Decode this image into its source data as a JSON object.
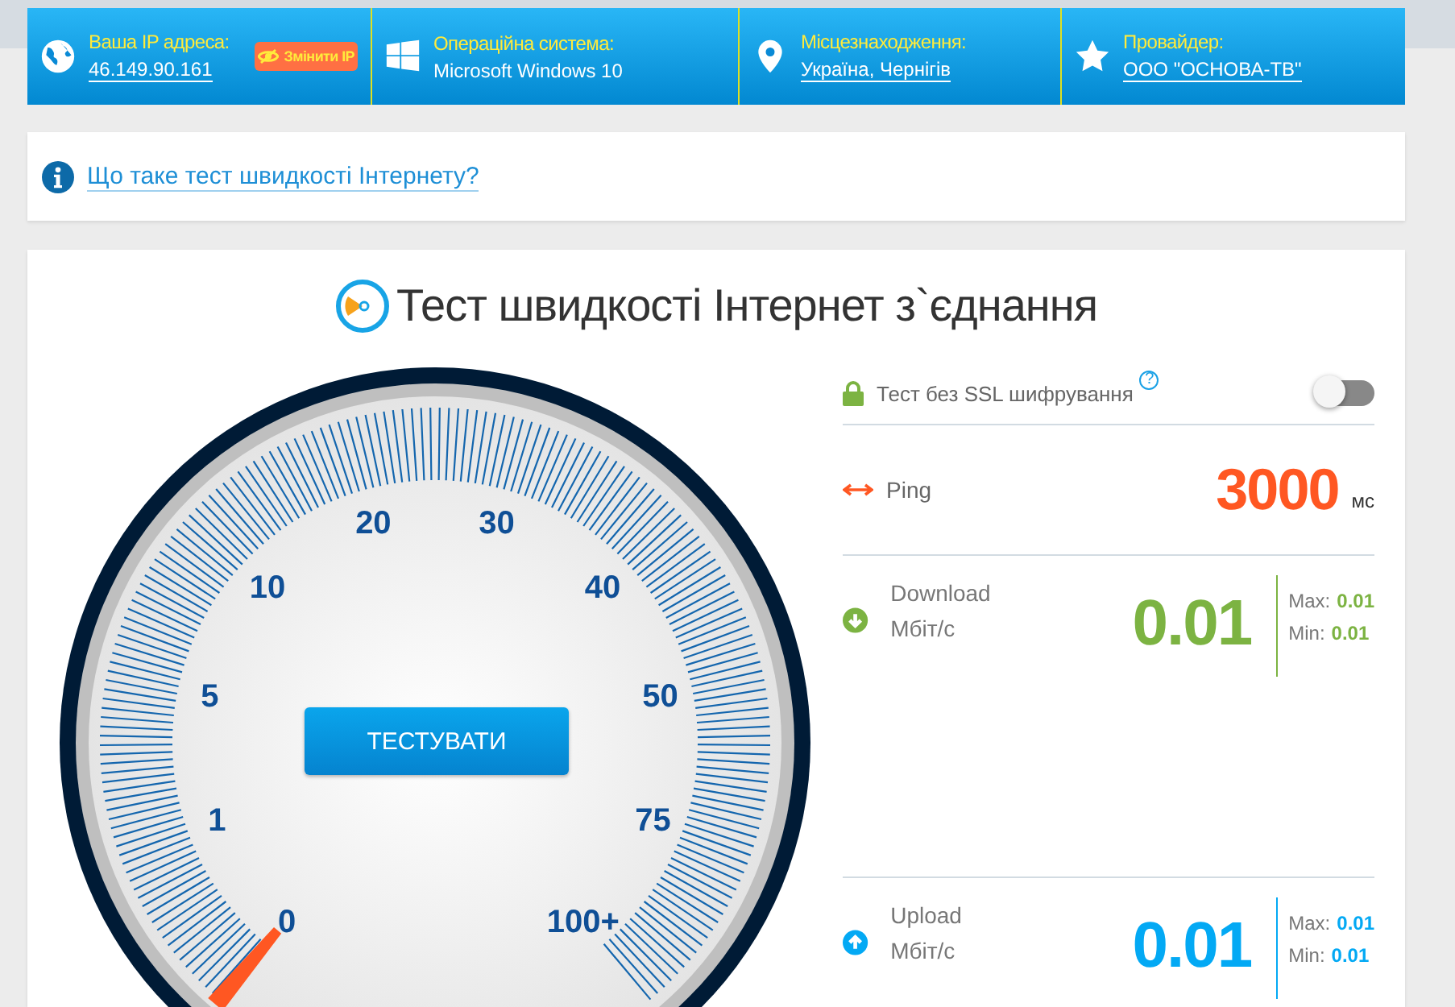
{
  "info_bar": [
    {
      "kind": "ip",
      "label": "Ваша IP адреса:",
      "value": "46.149.90.161",
      "link": true,
      "button": "Змінити IP"
    },
    {
      "kind": "os",
      "label": "Операційна система:",
      "value": "Microsoft Windows 10",
      "link": false
    },
    {
      "kind": "location",
      "label": "Місцезнаходження:",
      "value": "Україна, Чернігів",
      "link": true
    },
    {
      "kind": "provider",
      "label": "Провайдер:",
      "value": "ООО \"ОСНОВА-ТВ\"",
      "link": true
    }
  ],
  "info_link": "Що таке тест швидкості Інтернету?",
  "speed_test": {
    "title": "Тест швидкості Інтернет з`єднання",
    "button": "ТЕСТУВАТИ",
    "gauge": {
      "labels": [
        "0",
        "1",
        "5",
        "10",
        "20",
        "30",
        "40",
        "50",
        "75",
        "100+"
      ]
    },
    "ssl": {
      "label": "Тест без SSL шифрування",
      "help": "?",
      "on": false
    },
    "ping": {
      "label": "Ping",
      "value": "3000",
      "unit": "мс"
    },
    "results": [
      {
        "kind": "download",
        "label": "Download",
        "unit": "Мбіт/с",
        "value": "0.01",
        "color": "#7cb342",
        "max_label": "Max:",
        "max": "0.01",
        "min_label": "Min:",
        "min": "0.01"
      },
      {
        "kind": "upload",
        "label": "Upload",
        "unit": "Мбіт/с",
        "value": "0.01",
        "color": "#03a9f4",
        "max_label": "Max:",
        "max": "0.01",
        "min_label": "Min:",
        "min": "0.01"
      }
    ]
  }
}
